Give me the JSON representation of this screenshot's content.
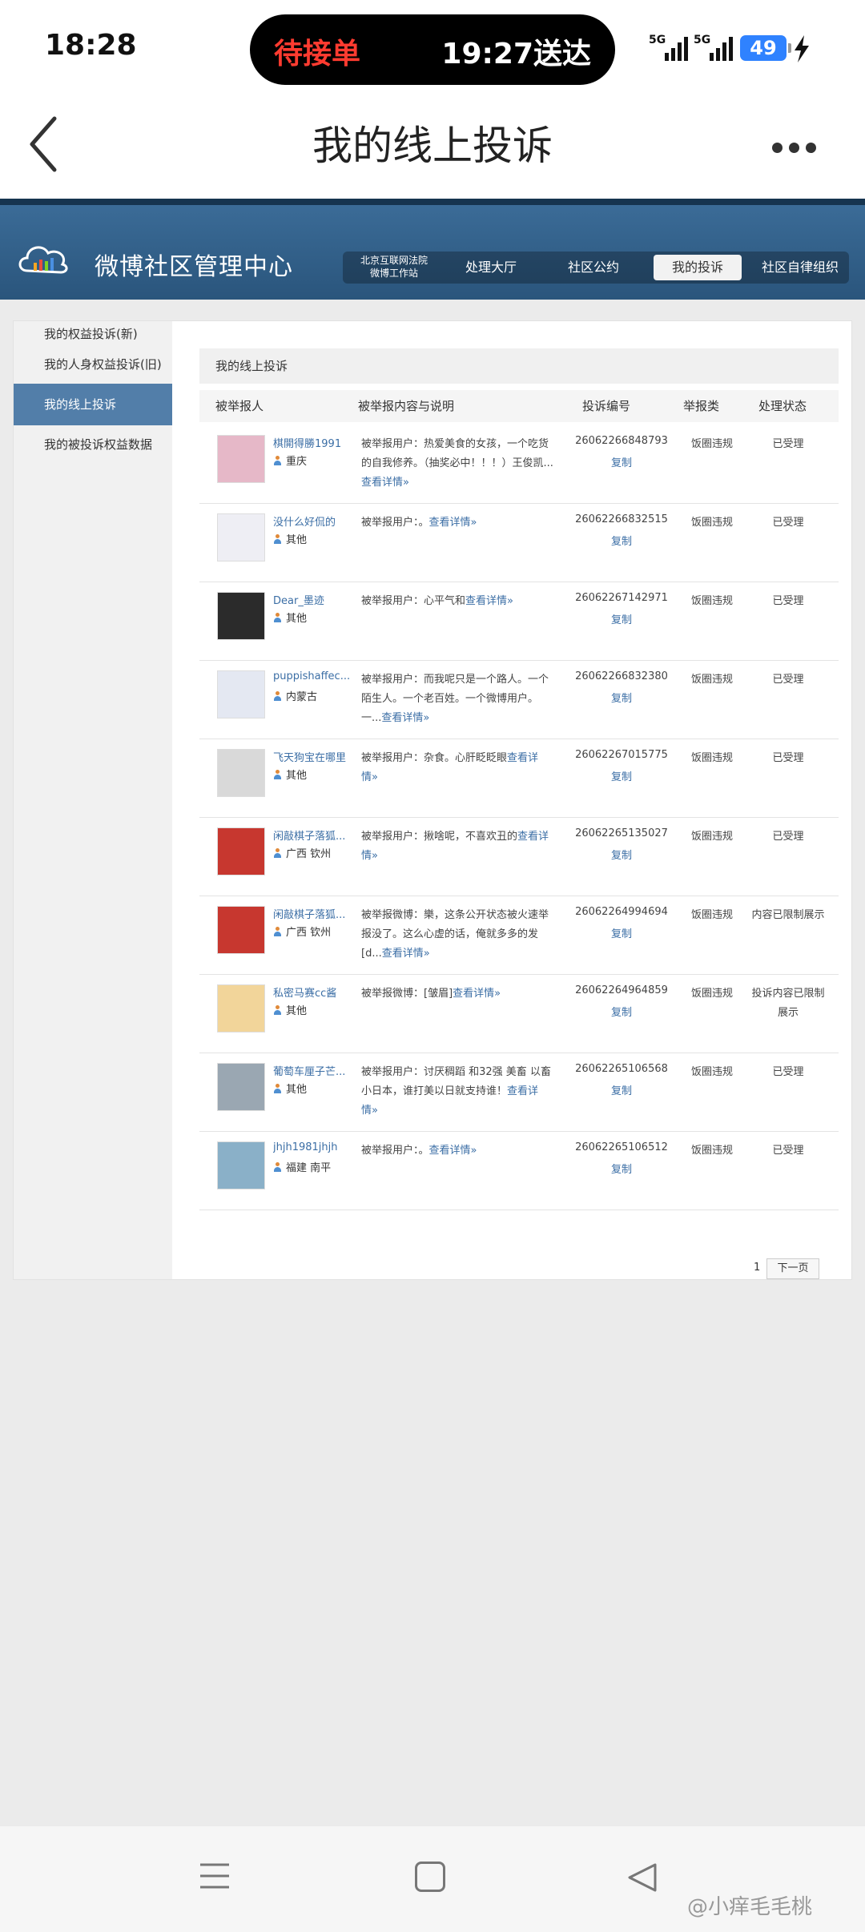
{
  "status": {
    "time": "18:28",
    "island_left": "待接单",
    "island_right": "19:27送达",
    "battery": "49",
    "signal_label": "5G"
  },
  "header": {
    "title": "我的线上投诉"
  },
  "banner": {
    "brand": "微博社区管理中心",
    "court_line1": "北京互联网法院",
    "court_line2": "微博工作站",
    "nav": [
      "处理大厅",
      "社区公约",
      "我的投诉",
      "社区自律组织"
    ],
    "active_nav": "我的投诉"
  },
  "sidebar": {
    "items": [
      "我的权益投诉(新)",
      "我的人身权益投诉(旧)",
      "我的线上投诉",
      "我的被投诉权益数据"
    ],
    "active": "我的线上投诉"
  },
  "main": {
    "section_title": "我的线上投诉",
    "columns": [
      "被举报人",
      "被举报内容与说明",
      "投诉编号",
      "举报类",
      "处理状态"
    ],
    "copy_label": "复制",
    "detail_label": "查看详情»",
    "rows": [
      {
        "name": "棋開得勝1991",
        "location": "重庆",
        "desc": "被举报用户：热爱美食的女孩，一个吃货的自我修养。（抽奖必中！！！）王俊凯...",
        "no": "26062266848793",
        "type": "饭圈违规",
        "status": "已受理"
      },
      {
        "name": "没什么好侃的",
        "location": "其他",
        "desc": "被举报用户：。",
        "no": "26062266832515",
        "type": "饭圈违规",
        "status": "已受理"
      },
      {
        "name": "Dear_墨迹",
        "location": "其他",
        "desc": "被举报用户：心平气和",
        "no": "26062267142971",
        "type": "饭圈违规",
        "status": "已受理"
      },
      {
        "name": "puppishaffec...",
        "location": "内蒙古",
        "desc": "被举报用户：而我呢只是一个路人。一个陌生人。一个老百姓。一个微博用户。一...",
        "no": "26062266832380",
        "type": "饭圈违规",
        "status": "已受理"
      },
      {
        "name": "飞天狗宝在哪里",
        "location": "其他",
        "desc": "被举报用户：杂食。心肝眨眨眼",
        "no": "26062267015775",
        "type": "饭圈违规",
        "status": "已受理"
      },
      {
        "name": "闲敲棋子落狐...",
        "location": "广西 钦州",
        "desc": "被举报用户：揪啥呢，不喜欢丑的",
        "no": "26062265135027",
        "type": "饭圈违规",
        "status": "已受理"
      },
      {
        "name": "闲敲棋子落狐...",
        "location": "广西 钦州",
        "desc": "被举报微博：樂，这条公开状态被火速举报没了。这么心虚的话，俺就多多的发[d...",
        "no": "26062264994694",
        "type": "饭圈违规",
        "status": "内容已限制展示"
      },
      {
        "name": "私密马赛cc酱",
        "location": "其他",
        "desc": "被举报微博：[皱眉]",
        "no": "26062264964859",
        "type": "饭圈违规",
        "status": "投诉内容已限制展示"
      },
      {
        "name": "葡萄车厘子芒...",
        "location": "其他",
        "desc": "被举报用户：讨厌稠蹈 和32强 美畜 以畜小日本，谁打美以日就支持谁！",
        "no": "26062265106568",
        "type": "饭圈违规",
        "status": "已受理"
      },
      {
        "name": "jhjh1981jhjh",
        "location": "福建 南平",
        "desc": "被举报用户：。",
        "no": "26062265106512",
        "type": "饭圈违规",
        "status": "已受理"
      }
    ],
    "page": "1",
    "next_label": "下一页"
  },
  "watermark": "@小痒毛毛桃",
  "colors": {
    "banner": "#3c6d99",
    "sidebar_active": "#527ea9",
    "link": "#3b6ea5",
    "island_alert": "#ff3b30"
  }
}
